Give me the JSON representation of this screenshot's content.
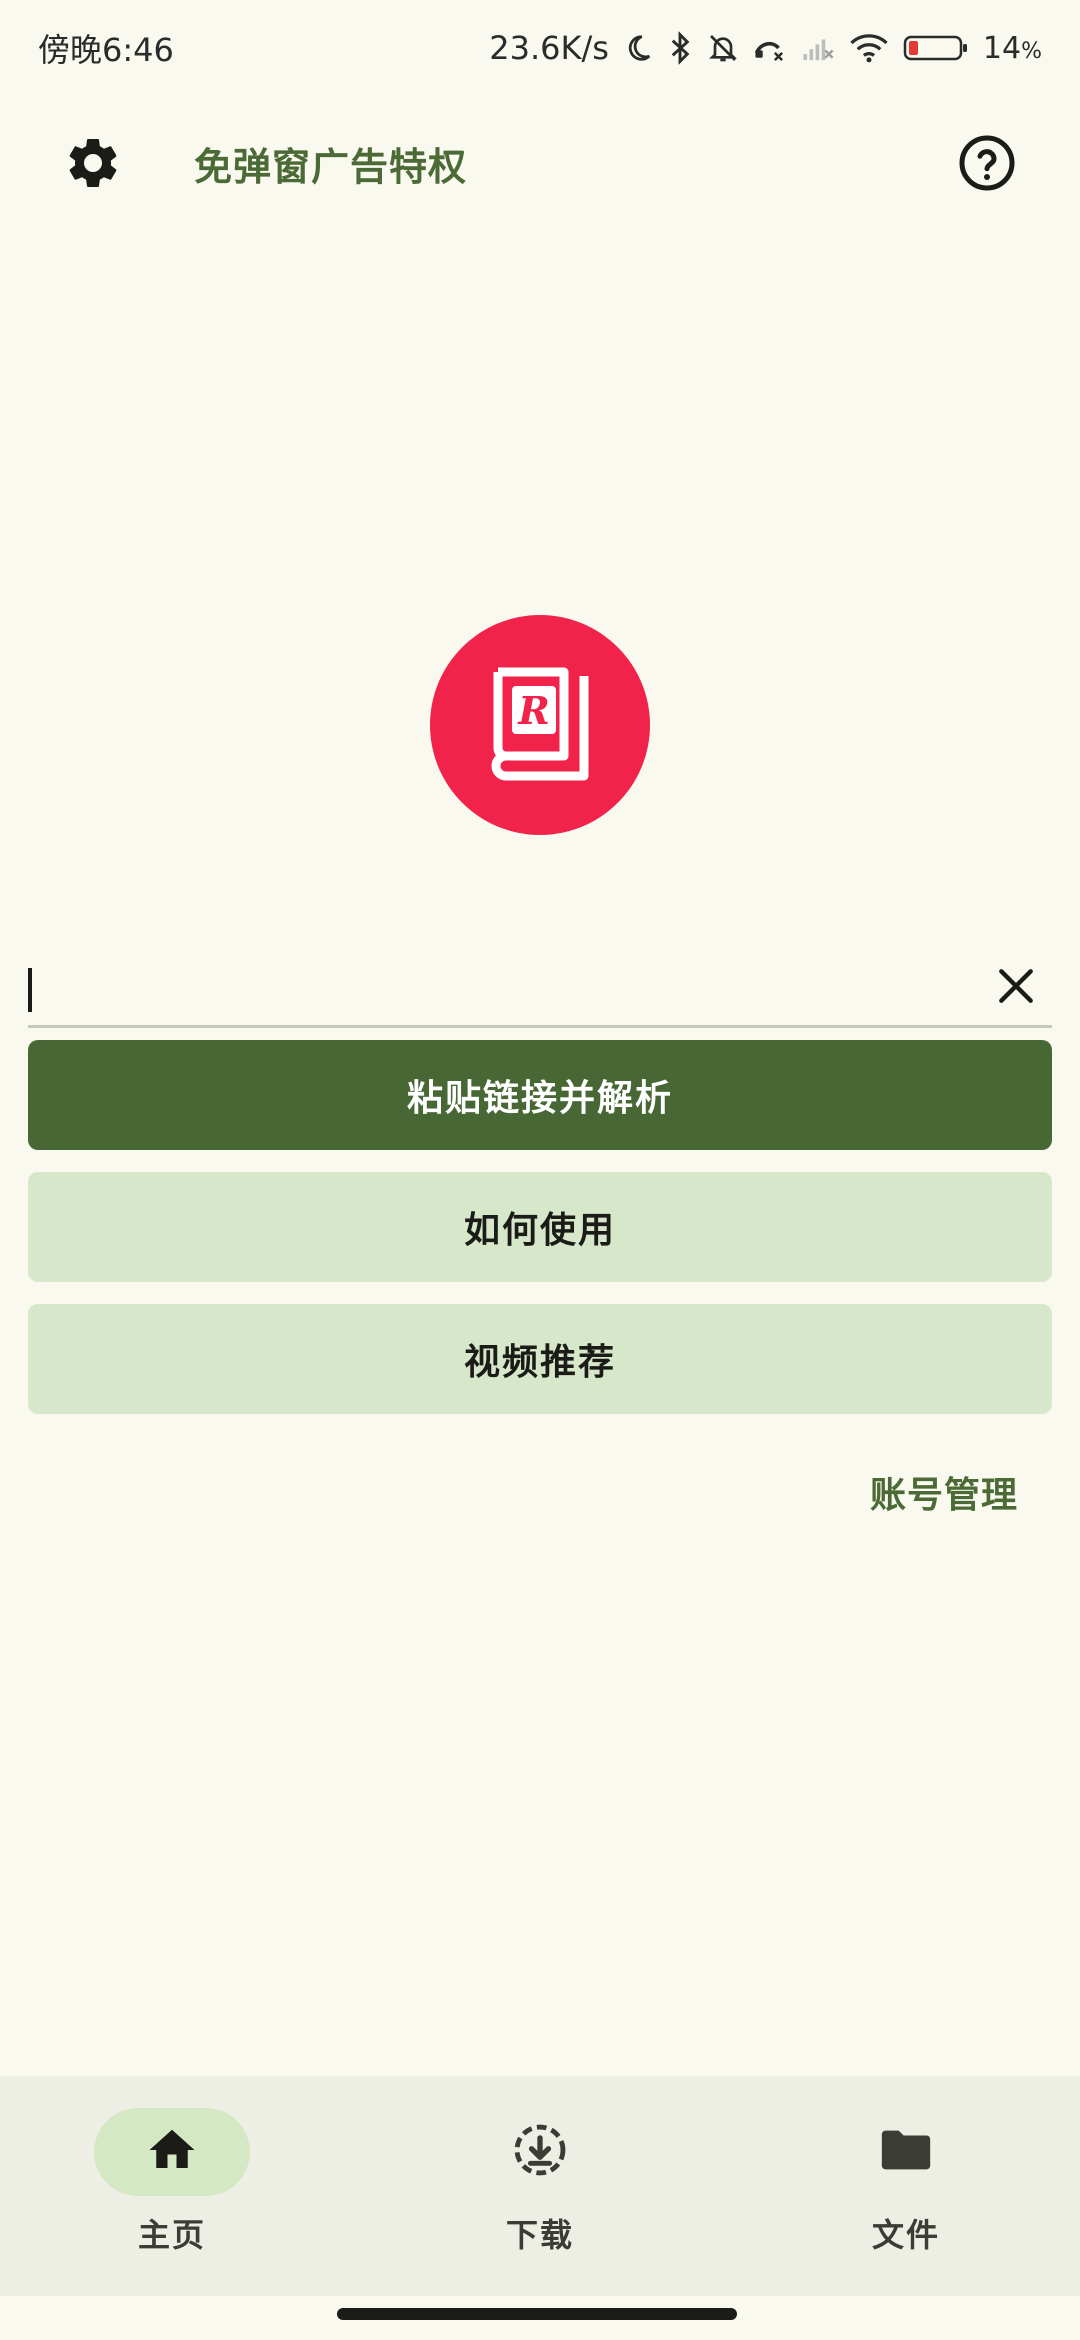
{
  "status_bar": {
    "time": "傍晚6:46",
    "net_speed": "23.6K/s",
    "battery": "14",
    "battery_unit": "%",
    "icons": [
      "moon-icon",
      "bluetooth-icon",
      "bell-off-icon",
      "call-missed-icon",
      "signal-off-icon",
      "wifi-icon",
      "battery-low-icon"
    ]
  },
  "top_bar": {
    "title": "免弹窗广告特权",
    "left_icon": "gear-icon",
    "right_icon": "help-circle-icon"
  },
  "logo": {
    "icon": "book-r-logo",
    "letter": "R",
    "color": "#f2234a"
  },
  "input": {
    "value": "",
    "placeholder": "",
    "clear_icon": "close-icon"
  },
  "buttons": {
    "paste_parse": "粘贴链接并解析",
    "how_to_use": "如何使用",
    "video_recommend": "视频推荐"
  },
  "account_link": "账号管理",
  "bottom_nav": {
    "items": [
      {
        "label": "主页",
        "icon": "home-icon",
        "active": true
      },
      {
        "label": "下载",
        "icon": "download-circle-icon",
        "active": false
      },
      {
        "label": "文件",
        "icon": "folder-icon",
        "active": false
      }
    ]
  },
  "colors": {
    "background": "#f9f9f0",
    "primary": "#476834",
    "tonal": "#d7e7c9",
    "accent_text": "#4b6a35",
    "nav_background": "#edefe4",
    "logo_red": "#f2234a"
  }
}
